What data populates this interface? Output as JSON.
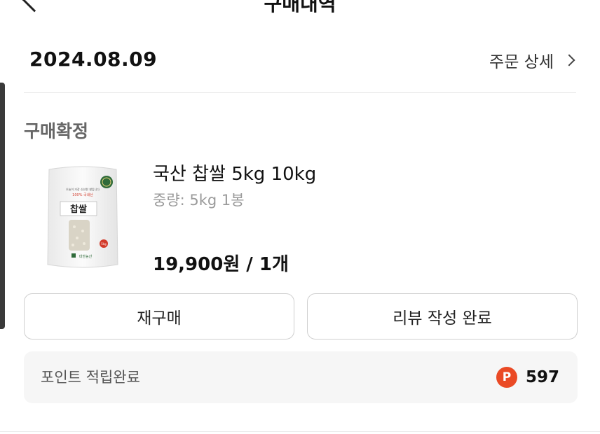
{
  "header": {
    "title": "구매내역"
  },
  "order": {
    "date": "2024.08.09",
    "detail_link": "주문 상세",
    "status": "구매확정"
  },
  "product": {
    "name": "국산 찹쌀 5kg 10kg",
    "option": "중량: 5kg 1봉",
    "price": "19,900원 / 1개",
    "image": {
      "bag_title": "찹쌀",
      "bag_tagline": "100% 국내산",
      "bag_small_text": "오늘이 가장 신선한 쌀입니다",
      "bag_maker": "대한농산",
      "bag_weight": "5kg"
    }
  },
  "actions": {
    "rebuy_label": "재구매",
    "review_label": "리뷰 작성 완료"
  },
  "points": {
    "label": "포인트 적립완료",
    "icon_letter": "P",
    "value": "597"
  },
  "colors": {
    "point_accent": "#ea4a25",
    "status_text": "#666666",
    "secondary_text": "#9a9a9a"
  }
}
